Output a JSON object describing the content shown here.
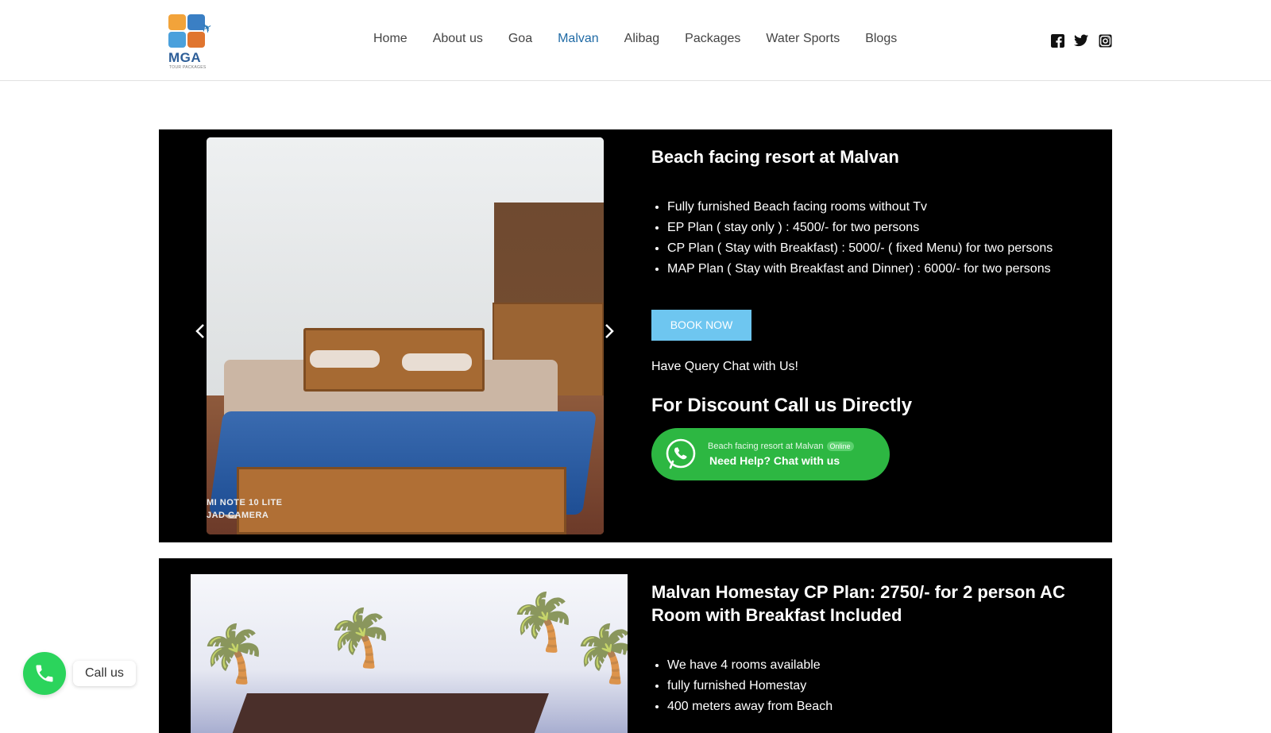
{
  "brand": {
    "logo_text": "MGA",
    "logo_sub": "TOUR PACKAGES"
  },
  "nav": {
    "items": [
      "Home",
      "About us",
      "Goa",
      "Malvan",
      "Alibag",
      "Packages",
      "Water Sports",
      "Blogs"
    ],
    "active": "Malvan",
    "active_color": "#1f6aa5"
  },
  "social": [
    "facebook-icon",
    "twitter-icon",
    "instagram-icon"
  ],
  "card1": {
    "title": "Beach facing resort at Malvan",
    "features": [
      "Fully furnished Beach facing rooms without Tv",
      "EP Plan ( stay only ) : 4500/- for two persons",
      "CP Plan ( Stay with Breakfast) : 5000/- ( fixed Menu) for two persons",
      "MAP Plan ( Stay with Breakfast and Dinner) : 6000/- for two persons"
    ],
    "book_label": "BOOK NOW",
    "query_text": "Have Query Chat with Us!",
    "discount_text": "For Discount Call us Directly",
    "photo_watermark_1": "MI NOTE 10 LITE",
    "photo_watermark_2": "JAD CAMERA",
    "whatsapp": {
      "small_text": "Beach facing resort at Malvan",
      "badge": "Online",
      "main_text": "Need Help? Chat with us",
      "color": "#2db742"
    }
  },
  "card2": {
    "title": "Malvan Homestay CP Plan: 2750/- for 2 person AC Room with Breakfast Included",
    "features": [
      "We have 4 rooms available",
      "fully furnished Homestay",
      "400 meters away from Beach"
    ]
  },
  "call_widget": {
    "label": "Call us",
    "color": "#2bd45c"
  }
}
